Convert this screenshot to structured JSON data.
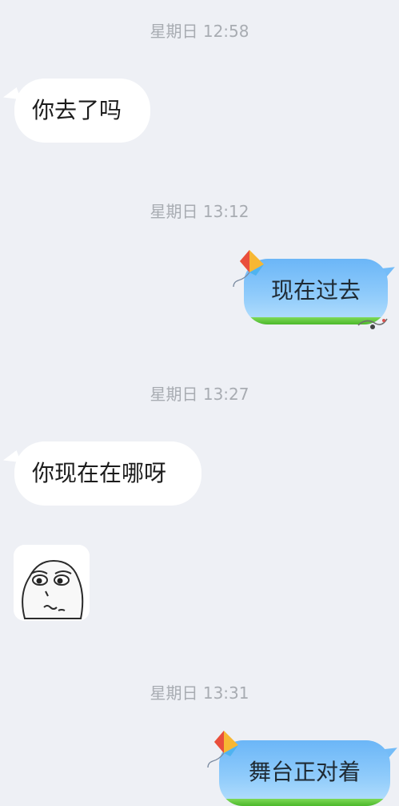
{
  "messages": {
    "ts1": "星期日 12:58",
    "msg1": "你去了吗",
    "ts2": "星期日 13:12",
    "msg2": "现在过去",
    "ts3": "星期日 13:27",
    "msg3": "你现在在哪呀",
    "ts4": "星期日 13:31",
    "msg4": "舞台正对着"
  },
  "sticker": {
    "icon": "meme-face-sticker"
  },
  "colors": {
    "background": "#eef0f5",
    "incoming_bubble": "#ffffff",
    "outgoing_bubble": "#8fcbfb",
    "timestamp": "#a8acb2"
  }
}
